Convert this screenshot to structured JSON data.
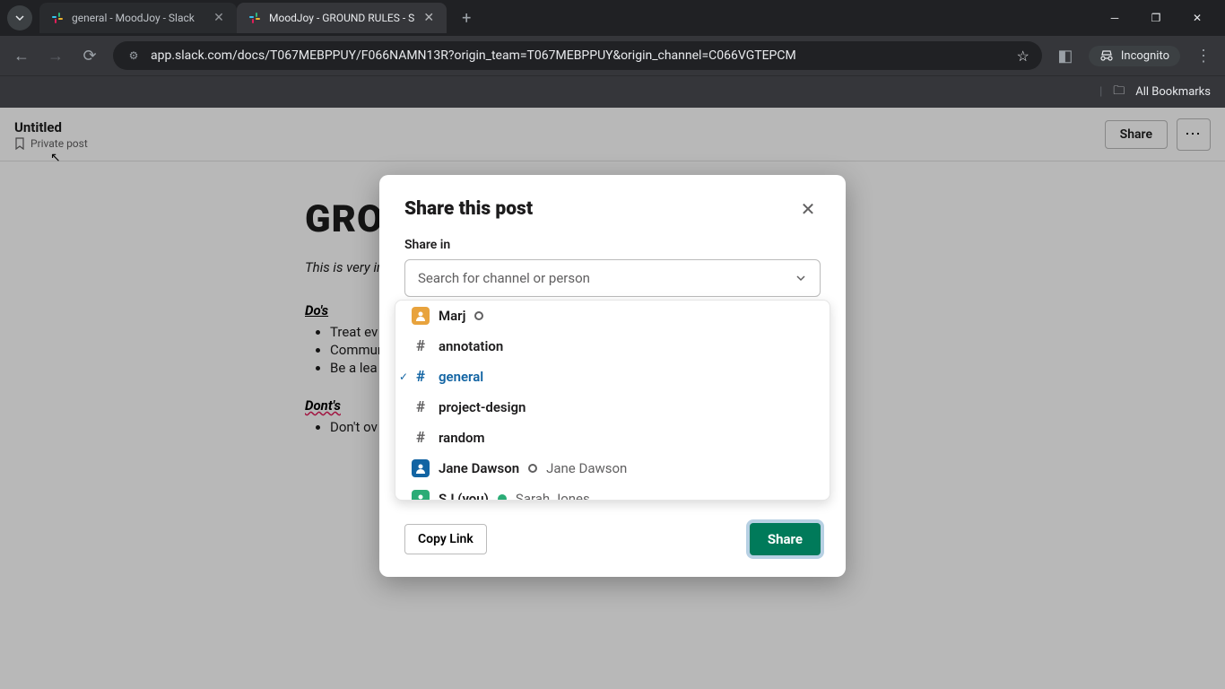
{
  "browser": {
    "tabs": [
      {
        "title": "general - MoodJoy - Slack",
        "active": false
      },
      {
        "title": "MoodJoy - GROUND RULES - S",
        "active": true
      }
    ],
    "url": "app.slack.com/docs/T067MEBPPUY/F066NAMN13R?origin_team=T067MEBPPUY&origin_channel=C066VGTEPCM",
    "incognito_label": "Incognito",
    "bookmarks_label": "All Bookmarks"
  },
  "doc": {
    "title": "Untitled",
    "subtitle": "Private post",
    "share_btn": "Share",
    "heading": "GRO",
    "intro": "This is very in",
    "dos_label": "Do's",
    "dos": [
      "Treat ev",
      "Commur",
      "Be a lea"
    ],
    "donts_label": "Dont's",
    "donts": [
      "Don't ov"
    ]
  },
  "modal": {
    "title": "Share this post",
    "share_in_label": "Share in",
    "search_placeholder": "Search for channel or person",
    "options": [
      {
        "type": "user",
        "name": "Marj",
        "avatar_color": "#e8a33d",
        "status": "away"
      },
      {
        "type": "channel",
        "name": "annotation"
      },
      {
        "type": "channel",
        "name": "general",
        "selected": true
      },
      {
        "type": "channel",
        "name": "project-design"
      },
      {
        "type": "channel",
        "name": "random"
      },
      {
        "type": "user",
        "name": "Jane Dawson",
        "secondary": "Jane Dawson",
        "avatar_color": "#1264a3",
        "status": "away"
      },
      {
        "type": "user",
        "name": "SJ (you)",
        "secondary": "Sarah Jones",
        "avatar_color": "#2bac76",
        "status": "active"
      }
    ],
    "copy_link_label": "Copy Link",
    "share_button_label": "Share"
  }
}
